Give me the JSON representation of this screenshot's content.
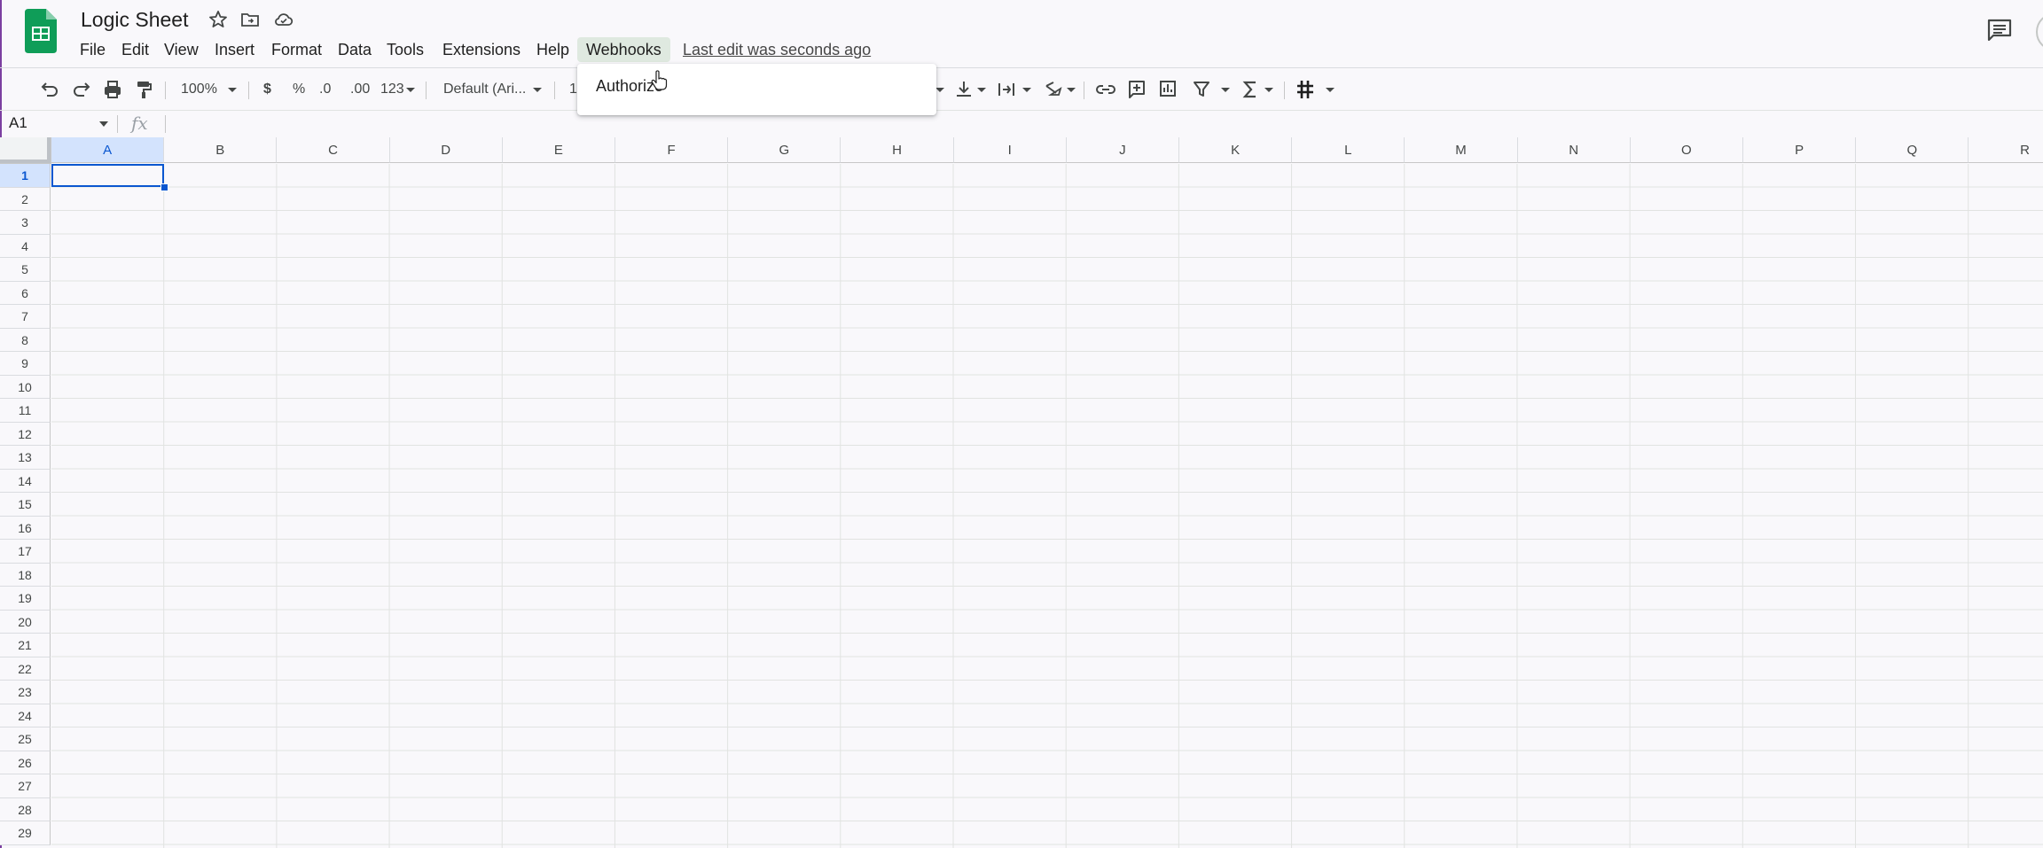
{
  "app": {
    "title": "Logic Sheet",
    "last_edit": "Last edit was seconds ago"
  },
  "menu": [
    {
      "label": "File"
    },
    {
      "label": "Edit"
    },
    {
      "label": "View"
    },
    {
      "label": "Insert"
    },
    {
      "label": "Format"
    },
    {
      "label": "Data"
    },
    {
      "label": "Tools"
    },
    {
      "label": "Extensions"
    },
    {
      "label": "Help"
    },
    {
      "label": "Webhooks"
    }
  ],
  "toolbar": {
    "zoom": "100%",
    "currency": "$",
    "percent": "%",
    "decrease_decimal": ".0",
    "increase_decimal": ".00",
    "number_format": "123",
    "font": "Default (Ari...",
    "font_size_partial": "1"
  },
  "formula_bar": {
    "name_box": "A1",
    "fx": "fx"
  },
  "dropdown": {
    "items": [
      {
        "label": "Authorize"
      }
    ]
  },
  "grid": {
    "columns": [
      "A",
      "B",
      "C",
      "D",
      "E",
      "F",
      "G",
      "H",
      "I",
      "J",
      "K",
      "L",
      "M",
      "N",
      "O",
      "P",
      "Q",
      "R"
    ],
    "rows": [
      "1",
      "2",
      "3",
      "4",
      "5",
      "6",
      "7",
      "8",
      "9",
      "10",
      "11",
      "12",
      "13",
      "14",
      "15",
      "16",
      "17",
      "18",
      "19",
      "20",
      "21",
      "22",
      "23",
      "24",
      "25",
      "26",
      "27",
      "28",
      "29"
    ],
    "selected_cell": "A1"
  },
  "colors": {
    "sheets_green": "#0f9d58",
    "selection_blue": "#0b57d0",
    "menu_active_bg": "#dfe9e0"
  }
}
